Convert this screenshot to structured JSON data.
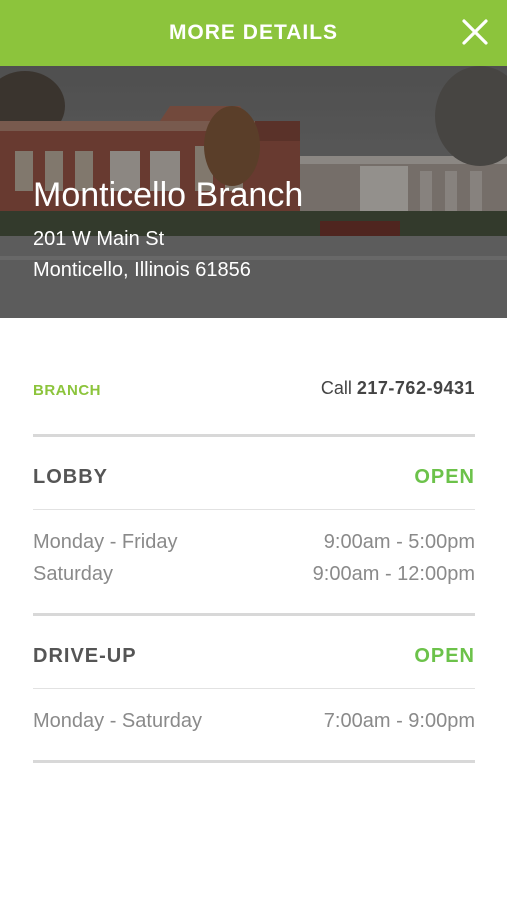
{
  "header": {
    "title": "MORE DETAILS",
    "close_icon": "close-icon",
    "bg_color": "#8cc43c"
  },
  "branch": {
    "name": "Monticello Branch",
    "address_line1": "201 W Main St",
    "address_line2": "Monticello, Illinois 61856",
    "type_label": "BRANCH",
    "call_prefix": "Call",
    "phone": "217-762-9431"
  },
  "lobby": {
    "title": "LOBBY",
    "status": "OPEN",
    "hours": [
      {
        "days": "Monday - Friday",
        "time": "9:00am - 5:00pm"
      },
      {
        "days": "Saturday",
        "time": "9:00am - 12:00pm"
      }
    ]
  },
  "driveup": {
    "title": "DRIVE-UP",
    "status": "OPEN",
    "hours": [
      {
        "days": "Monday - Saturday",
        "time": "7:00am - 9:00pm"
      }
    ]
  },
  "colors": {
    "accent": "#8cc43c",
    "open_status": "#6cc24a"
  }
}
